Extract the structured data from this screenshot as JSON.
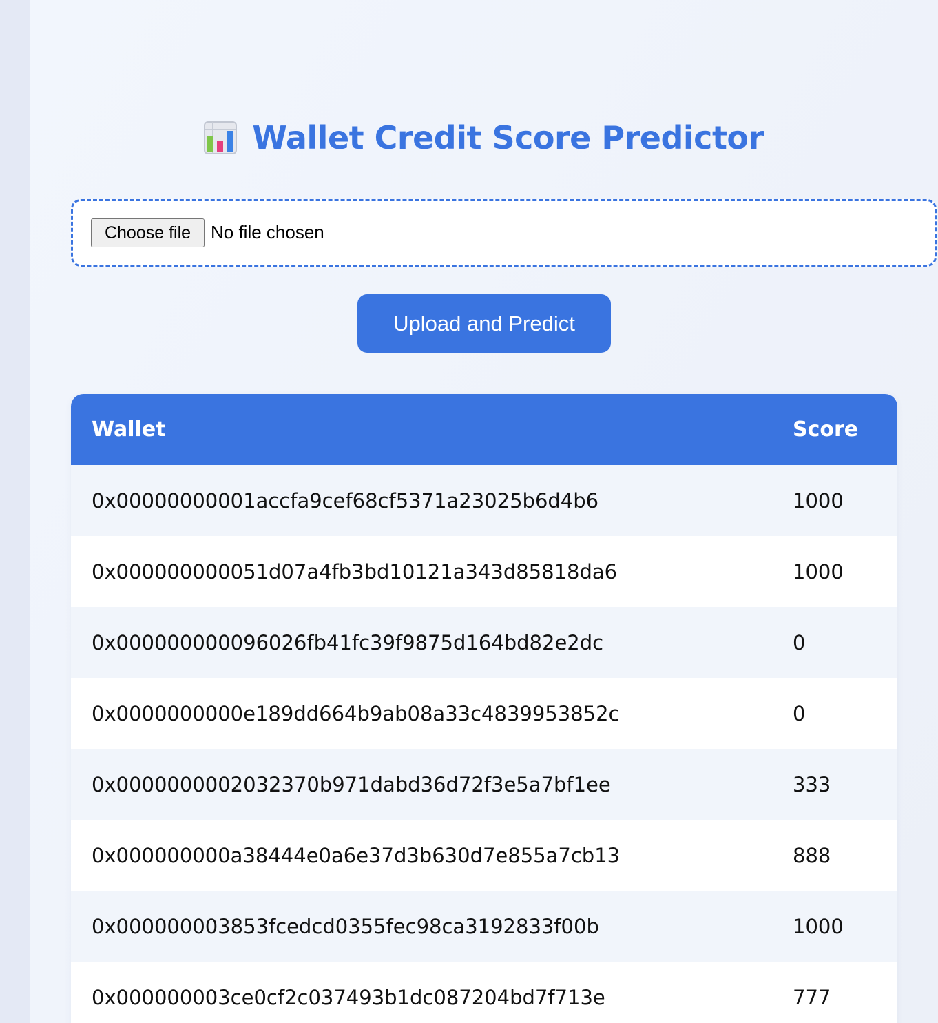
{
  "header": {
    "title": "Wallet Credit Score Predictor",
    "icon": "bar-chart-icon"
  },
  "upload": {
    "choose_label": "Choose file",
    "status": "No file chosen"
  },
  "actions": {
    "submit_label": "Upload and Predict"
  },
  "colors": {
    "accent": "#3a74e0",
    "row_alt": "#f1f5fb",
    "background": "#ecf0f8"
  },
  "table": {
    "columns": [
      "Wallet",
      "Score"
    ],
    "rows": [
      {
        "wallet": "0x00000000001accfa9cef68cf5371a23025b6d4b6",
        "score": "1000"
      },
      {
        "wallet": "0x000000000051d07a4fb3bd10121a343d85818da6",
        "score": "1000"
      },
      {
        "wallet": "0x000000000096026fb41fc39f9875d164bd82e2dc",
        "score": "0"
      },
      {
        "wallet": "0x0000000000e189dd664b9ab08a33c4839953852c",
        "score": "0"
      },
      {
        "wallet": "0x0000000002032370b971dabd36d72f3e5a7bf1ee",
        "score": "333"
      },
      {
        "wallet": "0x000000000a38444e0a6e37d3b630d7e855a7cb13",
        "score": "888"
      },
      {
        "wallet": "0x000000003853fcedcd0355fec98ca3192833f00b",
        "score": "1000"
      },
      {
        "wallet": "0x000000003ce0cf2c037493b1dc087204bd7f713e",
        "score": "777"
      }
    ]
  }
}
